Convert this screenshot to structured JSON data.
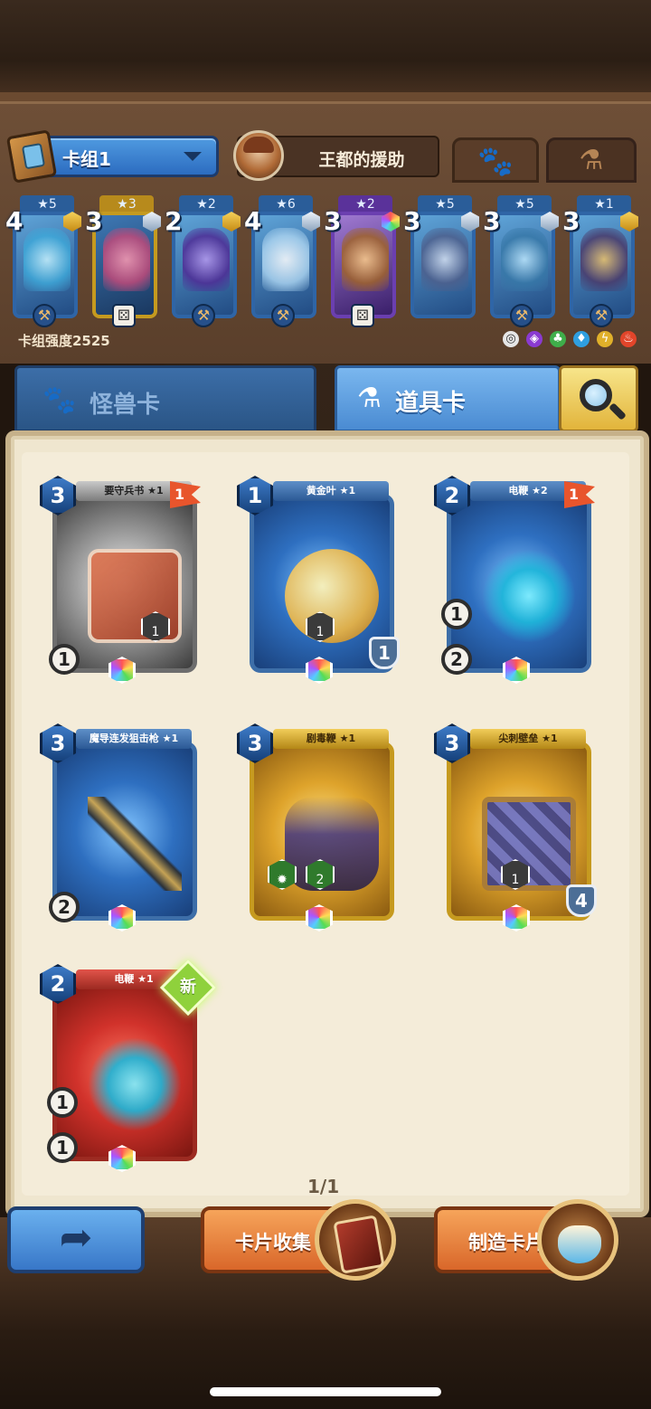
{
  "deck": {
    "selector_label": "卡组1",
    "hero_name": "王都的援助",
    "power_label": "卡组强度2525",
    "cards": [
      {
        "stars": "★5",
        "cost": "4",
        "gem": "gold",
        "bottom": "⚒"
      },
      {
        "stars": "★3",
        "cost": "3",
        "gem": "silver",
        "bottom": "⚄"
      },
      {
        "stars": "★2",
        "cost": "2",
        "gem": "gold",
        "bottom": "⚒"
      },
      {
        "stars": "★6",
        "cost": "4",
        "gem": "silver",
        "bottom": "⚒"
      },
      {
        "stars": "★2",
        "cost": "3",
        "gem": "rainbow",
        "bottom": "⚄"
      },
      {
        "stars": "★5",
        "cost": "3",
        "gem": "silver",
        "bottom": ""
      },
      {
        "stars": "★5",
        "cost": "3",
        "gem": "silver",
        "bottom": "⚒"
      },
      {
        "stars": "★1",
        "cost": "3",
        "gem": "gold",
        "bottom": "⚒"
      }
    ],
    "tab_pet_icon": "paw-icon",
    "tab_potion_icon": "potion-icon"
  },
  "categories": {
    "monster_label": "怪兽卡",
    "item_label": "道具卡"
  },
  "items": [
    {
      "name": "要守兵书 ★1",
      "cost": "3",
      "rank": "1",
      "stat1": "1",
      "mini": "1"
    },
    {
      "name": "黄金叶 ★1",
      "cost": "1",
      "stat1": "1",
      "mini": "1"
    },
    {
      "name": "电鞭 ★2",
      "cost": "2",
      "rank": "1",
      "stat1": "1",
      "stat2": "2"
    },
    {
      "name": "魔导连发狙击枪 ★1",
      "cost": "3",
      "stat1": "2"
    },
    {
      "name": "剧毒鞭 ★1",
      "cost": "3",
      "mini": "2"
    },
    {
      "name": "尖刺壁垒 ★1",
      "cost": "3",
      "stat1": "4",
      "mini": "1"
    },
    {
      "name": "电鞭 ★1",
      "cost": "2",
      "badge": "新",
      "stat1": "1",
      "stat2": "1"
    }
  ],
  "pagination": "1/1",
  "buttons": {
    "collect_label": "卡片收集",
    "craft_label": "制造卡片"
  },
  "colors": {
    "accent_blue": "#3877c8",
    "accent_orange": "#d9672a",
    "parchment": "#efe6cf"
  }
}
